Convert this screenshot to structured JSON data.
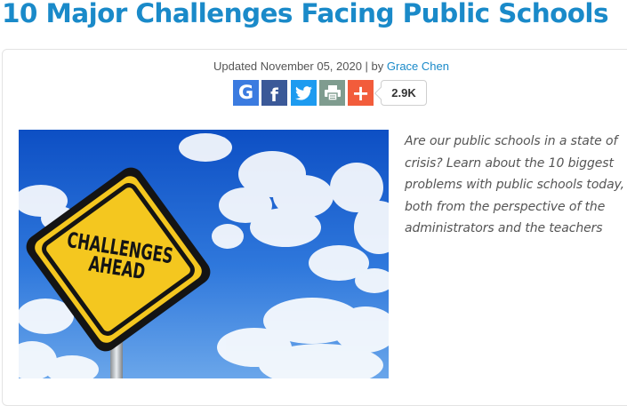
{
  "article": {
    "title": "10 Major Challenges Facing Public Schools",
    "byline_prefix": "Updated November 05, 2020 | by ",
    "author": "Grace Chen",
    "description": "Are our public schools in a state of crisis? Learn about the 10 biggest problems with public schools today, both from the perspective of the administrators and the teachers"
  },
  "share": {
    "buttons": [
      {
        "icon": "google-icon",
        "label": "G",
        "color": "#3b7be0"
      },
      {
        "icon": "facebook-icon",
        "label": "f",
        "color": "#3b5998"
      },
      {
        "icon": "twitter-icon",
        "label": "",
        "color": "#1d9bf0"
      },
      {
        "icon": "print-icon",
        "label": "",
        "color": "#7f9c8f"
      },
      {
        "icon": "plus-icon",
        "label": "+",
        "color": "#f25c3b"
      }
    ],
    "count": "2.9K"
  },
  "image": {
    "sign_line1": "CHALLENGES",
    "sign_line2": "AHEAD"
  }
}
